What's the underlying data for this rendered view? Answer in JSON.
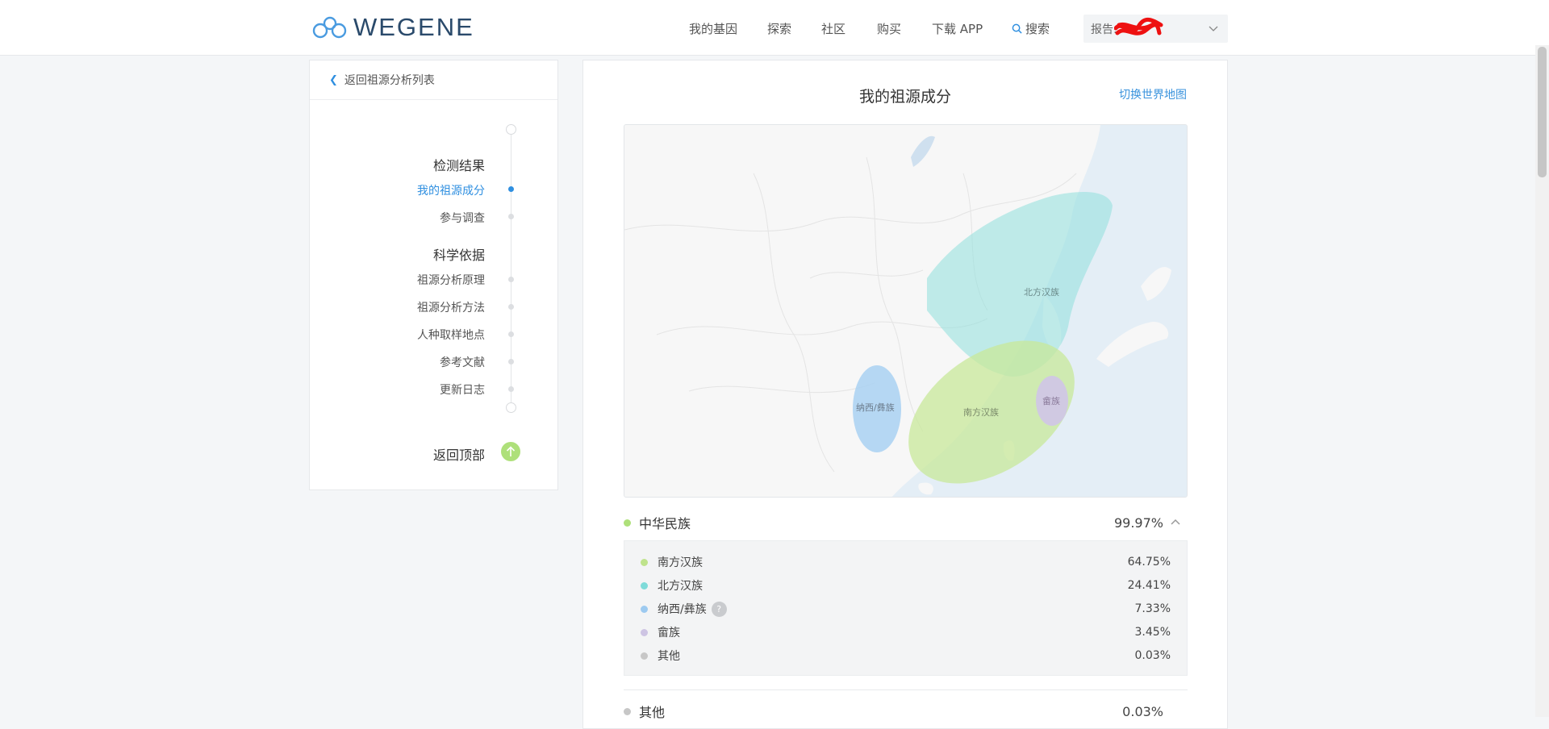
{
  "header": {
    "logo_text": "WEGENE",
    "nav": [
      "我的基因",
      "探索",
      "社区",
      "购买",
      "下载 APP"
    ],
    "search_label": "搜索",
    "report_label": "报告:"
  },
  "sidebar": {
    "back_label": "返回祖源分析列表",
    "sections": [
      {
        "title": "检测结果",
        "items": [
          "我的祖源成分",
          "参与调查"
        ]
      },
      {
        "title": "科学依据",
        "items": [
          "祖源分析原理",
          "祖源分析方法",
          "人种取样地点",
          "参考文献",
          "更新日志"
        ]
      }
    ],
    "active_item": "我的祖源成分",
    "back_top_label": "返回顶部"
  },
  "main": {
    "title": "我的祖源成分",
    "switch_map_label": "切换世界地图",
    "map_labels": [
      "北方汉族",
      "南方汉族",
      "纳西/彝族",
      "畲族"
    ],
    "groups": [
      {
        "name": "中华民族",
        "percent": "99.97%",
        "color": "#aee07a",
        "expanded": true,
        "items": [
          {
            "name": "南方汉族",
            "percent": "64.75%",
            "color": "#bfe38c"
          },
          {
            "name": "北方汉族",
            "percent": "24.41%",
            "color": "#7fdbd9"
          },
          {
            "name": "纳西/彝族",
            "percent": "7.33%",
            "color": "#9dcaf0",
            "help": "?"
          },
          {
            "name": "畲族",
            "percent": "3.45%",
            "color": "#cdc4e3"
          },
          {
            "name": "其他",
            "percent": "0.03%",
            "color": "#c7c7c7"
          }
        ]
      },
      {
        "name": "其他",
        "percent": "0.03%",
        "color": "#c7c7c7"
      }
    ]
  },
  "colors": {
    "accent": "#2f8fe0",
    "link": "#3a93dd",
    "green": "#aee07a"
  }
}
